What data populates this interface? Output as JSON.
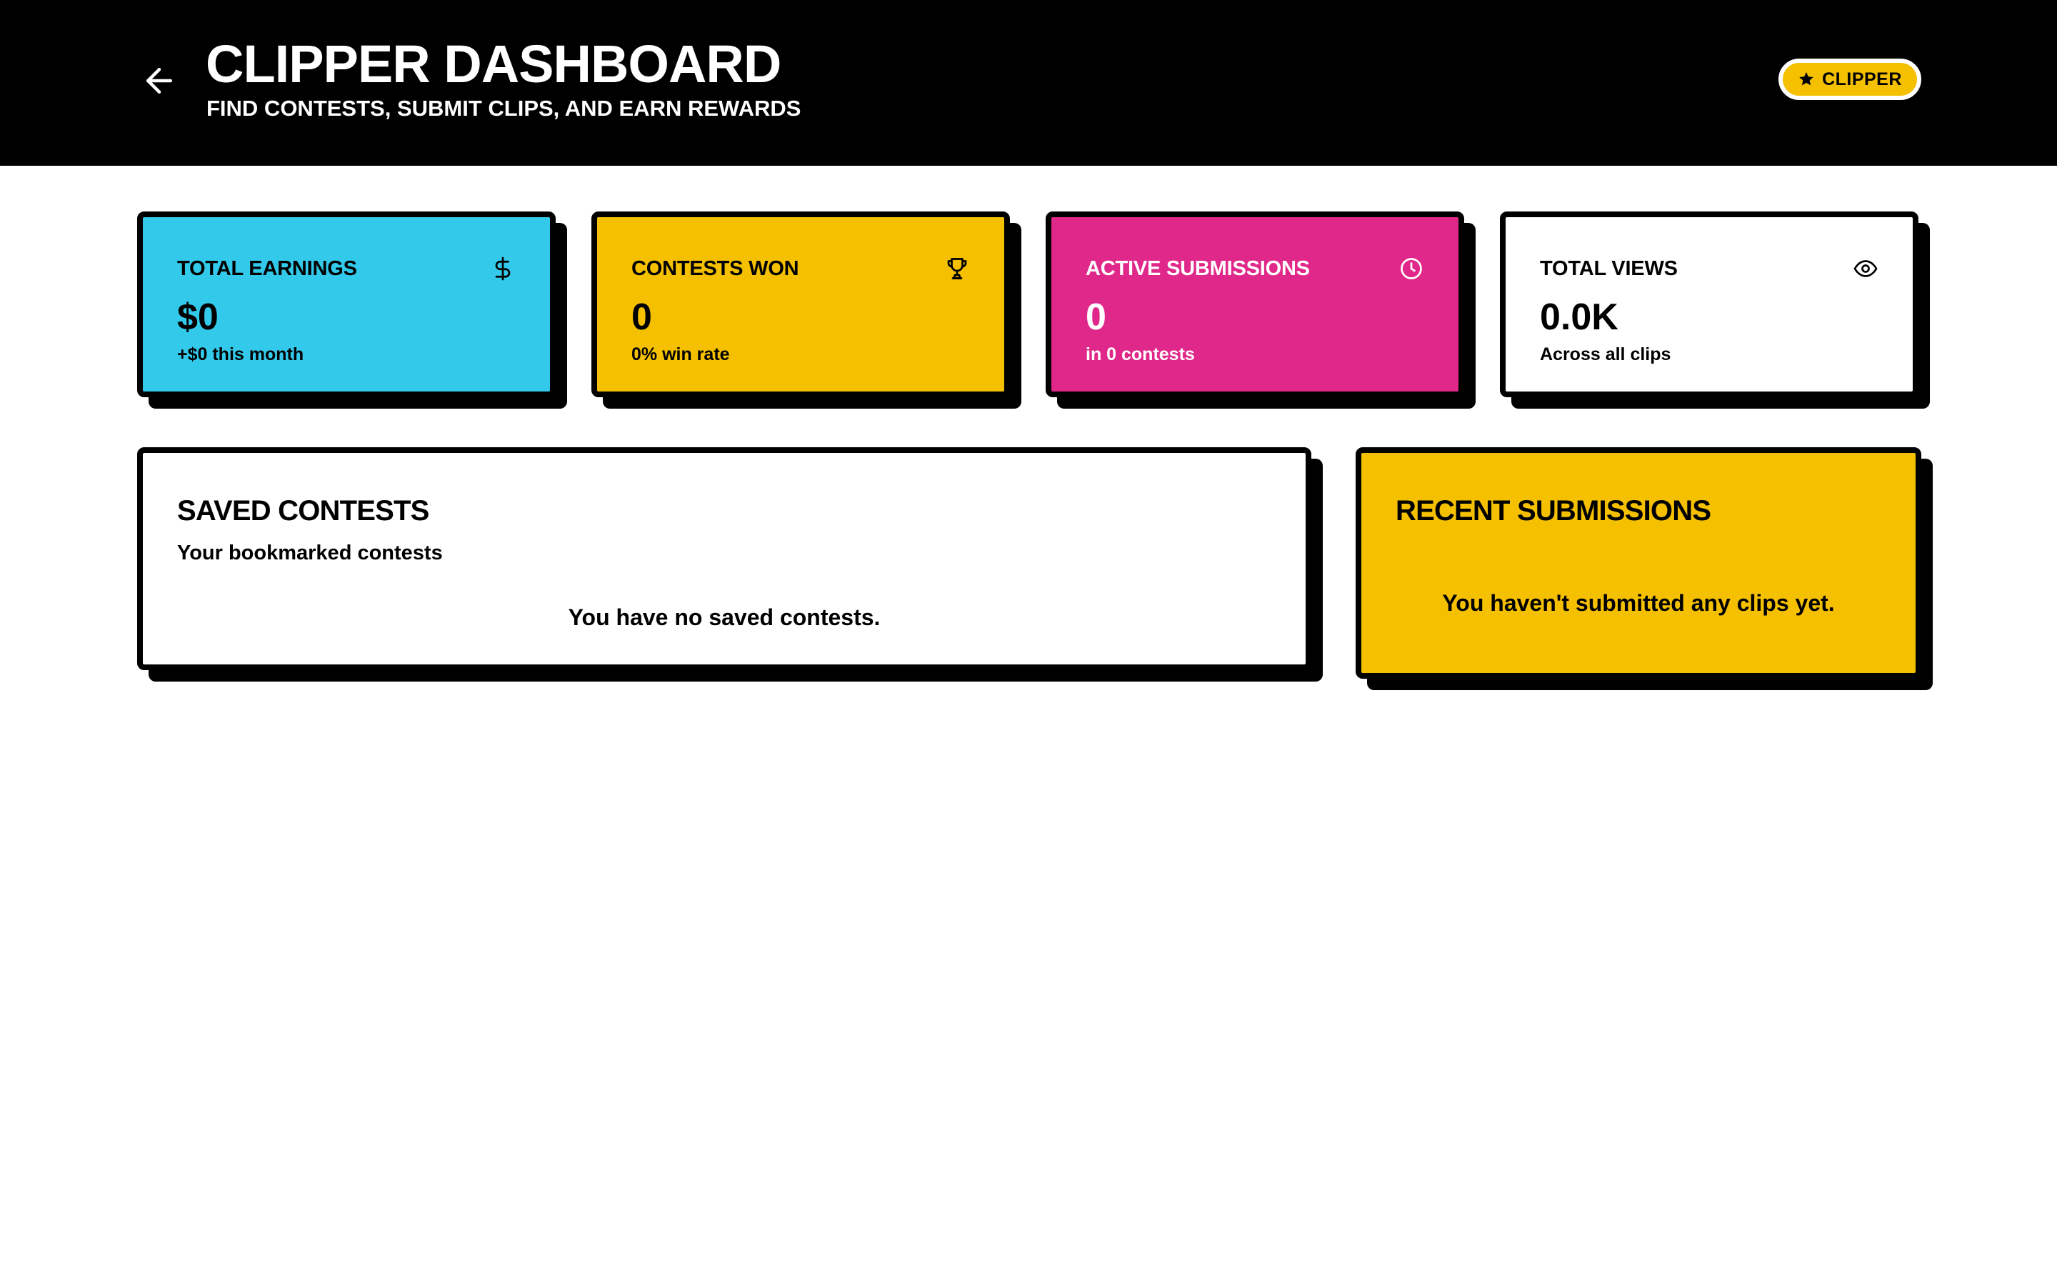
{
  "header": {
    "title": "CLIPPER DASHBOARD",
    "subtitle": "FIND CONTESTS, SUBMIT CLIPS, AND EARN REWARDS",
    "back_icon": "arrow-left-icon",
    "role_badge": {
      "label": "CLIPPER",
      "icon": "star-icon"
    }
  },
  "stats": [
    {
      "label": "TOTAL EARNINGS",
      "value": "$0",
      "sub": "+$0 this month",
      "icon": "dollar-icon",
      "color": "#33c9eb"
    },
    {
      "label": "CONTESTS WON",
      "value": "0",
      "sub": "0% win rate",
      "icon": "trophy-icon",
      "color": "#f5c000"
    },
    {
      "label": "ACTIVE SUBMISSIONS",
      "value": "0",
      "sub": "in 0 contests",
      "icon": "clock-icon",
      "color": "#e0288a"
    },
    {
      "label": "TOTAL VIEWS",
      "value": "0.0K",
      "sub": "Across all clips",
      "icon": "eye-icon",
      "color": "#ffffff"
    }
  ],
  "saved_contests": {
    "title": "SAVED CONTESTS",
    "subtitle": "Your bookmarked contests",
    "empty": "You have no saved contests."
  },
  "recent_submissions": {
    "title": "RECENT SUBMISSIONS",
    "empty": "You haven't submitted any clips yet.",
    "color": "#f5c000"
  }
}
